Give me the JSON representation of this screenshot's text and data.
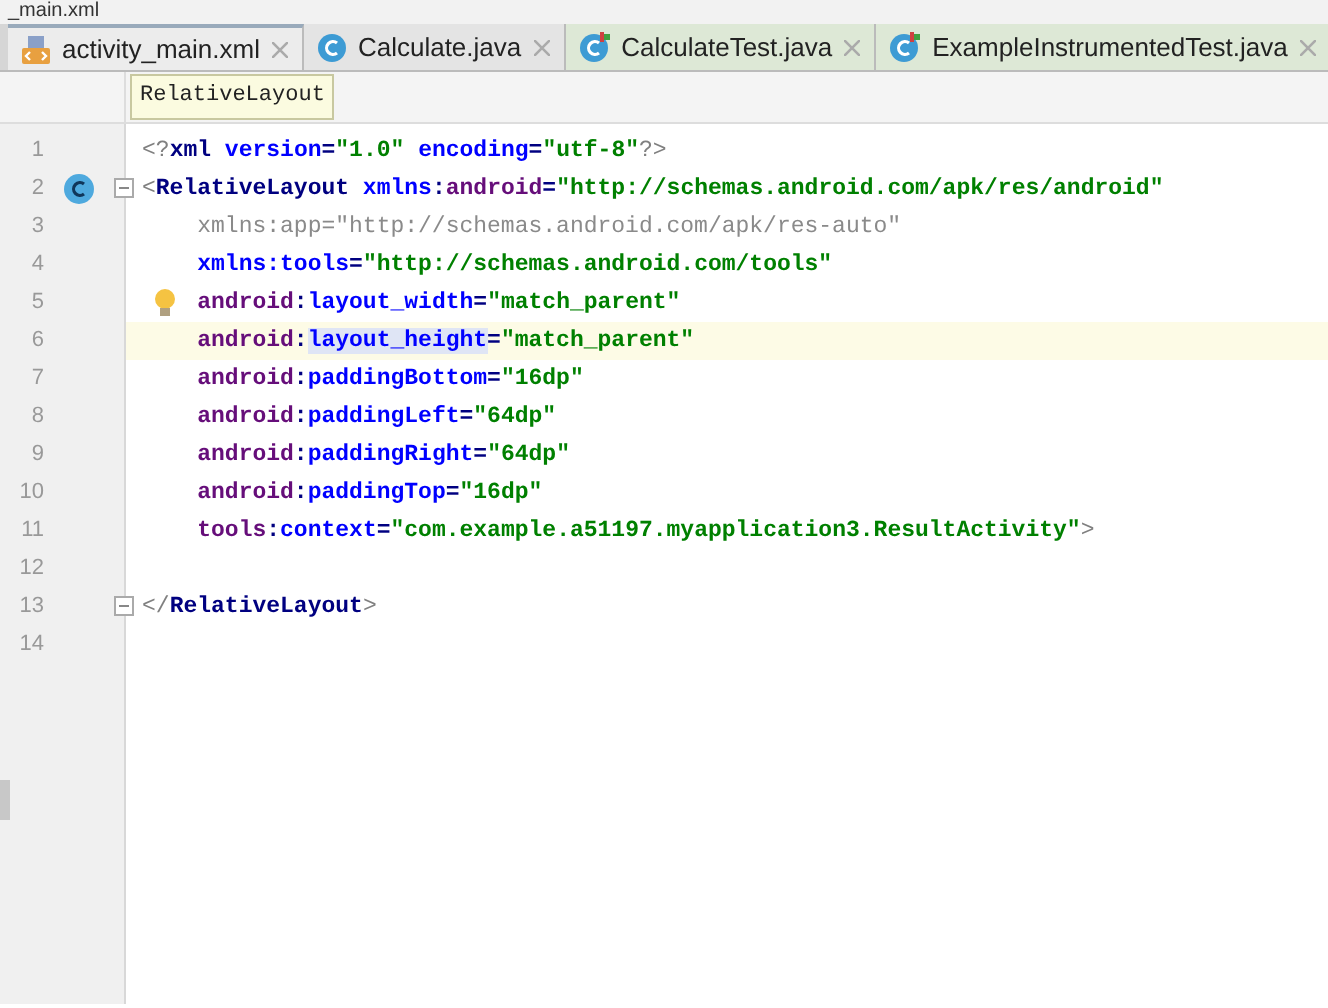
{
  "breadcrumb": "_main.xml",
  "tabs": [
    {
      "label": "activity_main.xml",
      "kind": "xml",
      "selected": true,
      "color": "#ececec"
    },
    {
      "label": "Calculate.java",
      "kind": "class",
      "selected": false,
      "color": "#e4e4e4"
    },
    {
      "label": "CalculateTest.java",
      "kind": "test",
      "selected": false,
      "color": "#dde8d6"
    },
    {
      "label": "ExampleInstrumentedTest.java",
      "kind": "test",
      "selected": false,
      "color": "#dde8d6"
    }
  ],
  "tooltip": "RelativeLayout",
  "lines": [
    {
      "number": "1",
      "current": false,
      "tokens": [
        {
          "text": "<?",
          "kind": "punct"
        },
        {
          "text": "xml",
          "kind": "tag"
        },
        {
          "text": " version",
          "kind": "attr"
        },
        {
          "text": "=",
          "kind": "plain"
        },
        {
          "text": "\"1.0\"",
          "kind": "value"
        },
        {
          "text": " encoding",
          "kind": "attr"
        },
        {
          "text": "=",
          "kind": "plain"
        },
        {
          "text": "\"utf-8\"",
          "kind": "value"
        },
        {
          "text": "?>",
          "kind": "punct"
        }
      ]
    },
    {
      "number": "2",
      "current": false,
      "kind": "class_marker",
      "fold": true,
      "tokens": [
        {
          "text": "<",
          "kind": "punct"
        },
        {
          "text": "RelativeLayout",
          "kind": "tag"
        },
        {
          "text": " xmlns",
          "kind": "attr"
        },
        {
          "text": ":",
          "kind": "plain"
        },
        {
          "text": "android",
          "kind": "ns"
        },
        {
          "text": "=",
          "kind": "plain"
        },
        {
          "text": "\"http://schemas.android.com/apk/res/android\"",
          "kind": "value"
        }
      ]
    },
    {
      "number": "3",
      "current": false,
      "tokens": [
        {
          "text": "    xmlns:app=\"http://schemas.android.com/apk/res-auto\"",
          "kind": "unused"
        }
      ]
    },
    {
      "number": "4",
      "current": false,
      "tokens": [
        {
          "text": "    xmlns:tools",
          "kind": "attr"
        },
        {
          "text": "=",
          "kind": "plain"
        },
        {
          "text": "\"http://schemas.android.com/tools\"",
          "kind": "value"
        }
      ]
    },
    {
      "number": "5",
      "current": false,
      "kind": "bulb_marker",
      "tokens": [
        {
          "text": "    android",
          "kind": "ns"
        },
        {
          "text": ":",
          "kind": "plain"
        },
        {
          "text": "layout_width",
          "kind": "attr"
        },
        {
          "text": "=",
          "kind": "plain"
        },
        {
          "text": "\"match_parent\"",
          "kind": "value"
        }
      ]
    },
    {
      "number": "6",
      "current": true,
      "tokens": [
        {
          "text": "    android",
          "kind": "ns"
        },
        {
          "text": ":",
          "kind": "plain"
        },
        {
          "text": "layout_height",
          "kind": "attr_selected"
        },
        {
          "text": "=",
          "kind": "plain"
        },
        {
          "text": "\"match_parent\"",
          "kind": "value"
        }
      ]
    },
    {
      "number": "7",
      "current": false,
      "tokens": [
        {
          "text": "    android",
          "kind": "ns"
        },
        {
          "text": ":",
          "kind": "plain"
        },
        {
          "text": "paddingBottom",
          "kind": "attr"
        },
        {
          "text": "=",
          "kind": "plain"
        },
        {
          "text": "\"16dp\"",
          "kind": "value"
        }
      ]
    },
    {
      "number": "8",
      "current": false,
      "tokens": [
        {
          "text": "    android",
          "kind": "ns"
        },
        {
          "text": ":",
          "kind": "plain"
        },
        {
          "text": "paddingLeft",
          "kind": "attr"
        },
        {
          "text": "=",
          "kind": "plain"
        },
        {
          "text": "\"64dp\"",
          "kind": "value"
        }
      ]
    },
    {
      "number": "9",
      "current": false,
      "tokens": [
        {
          "text": "    android",
          "kind": "ns"
        },
        {
          "text": ":",
          "kind": "plain"
        },
        {
          "text": "paddingRight",
          "kind": "attr"
        },
        {
          "text": "=",
          "kind": "plain"
        },
        {
          "text": "\"64dp\"",
          "kind": "value"
        }
      ]
    },
    {
      "number": "10",
      "current": false,
      "tokens": [
        {
          "text": "    android",
          "kind": "ns"
        },
        {
          "text": ":",
          "kind": "plain"
        },
        {
          "text": "paddingTop",
          "kind": "attr"
        },
        {
          "text": "=",
          "kind": "plain"
        },
        {
          "text": "\"16dp\"",
          "kind": "value"
        }
      ]
    },
    {
      "number": "11",
      "current": false,
      "tokens": [
        {
          "text": "    tools",
          "kind": "ns"
        },
        {
          "text": ":",
          "kind": "plain"
        },
        {
          "text": "context",
          "kind": "attr"
        },
        {
          "text": "=",
          "kind": "plain"
        },
        {
          "text": "\"com.example.a51197.myapplication3.ResultActivity\"",
          "kind": "value"
        },
        {
          "text": ">",
          "kind": "punct"
        }
      ]
    },
    {
      "number": "12",
      "current": false
    },
    {
      "number": "13",
      "current": false,
      "fold": true,
      "tokens": [
        {
          "text": "</",
          "kind": "punct"
        },
        {
          "text": "RelativeLayout",
          "kind": "tag"
        },
        {
          "text": ">",
          "kind": "punct"
        }
      ]
    },
    {
      "number": "14",
      "current": false
    }
  ]
}
